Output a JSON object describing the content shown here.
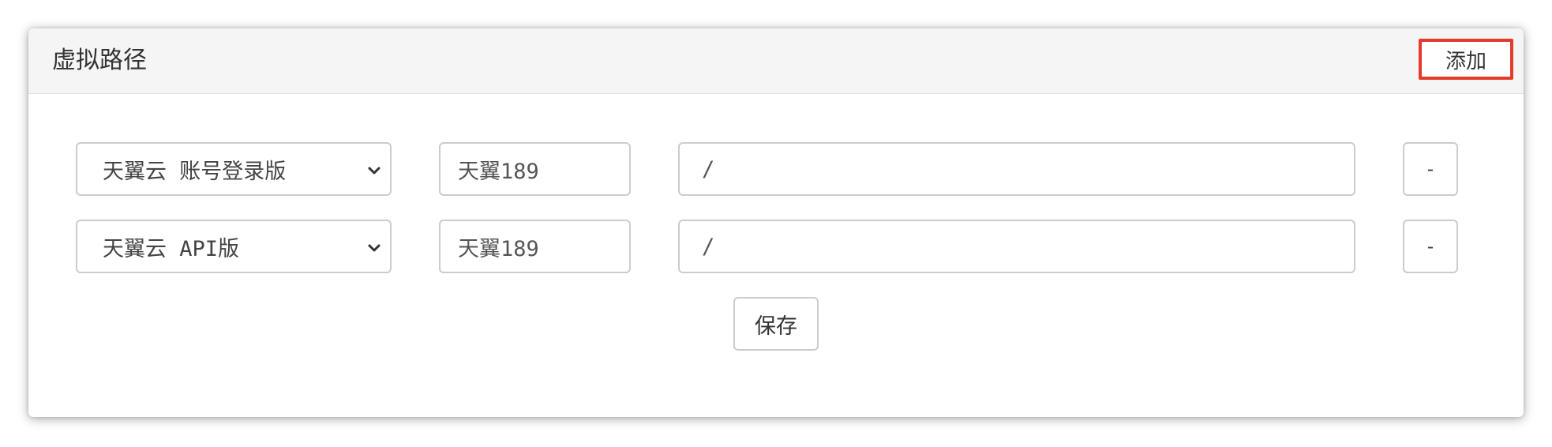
{
  "panel": {
    "title": "虚拟路径",
    "add_label": "添加",
    "add_highlight_color": "#e53a2a"
  },
  "rows": [
    {
      "provider": "天翼云 账号登录版",
      "name": "天翼189",
      "path": "/",
      "remove_label": "-"
    },
    {
      "provider": "天翼云 API版",
      "name": "天翼189",
      "path": "/",
      "remove_label": "-"
    }
  ],
  "save_label": "保存",
  "icons": {
    "dropdown": "chevron-down-icon"
  }
}
